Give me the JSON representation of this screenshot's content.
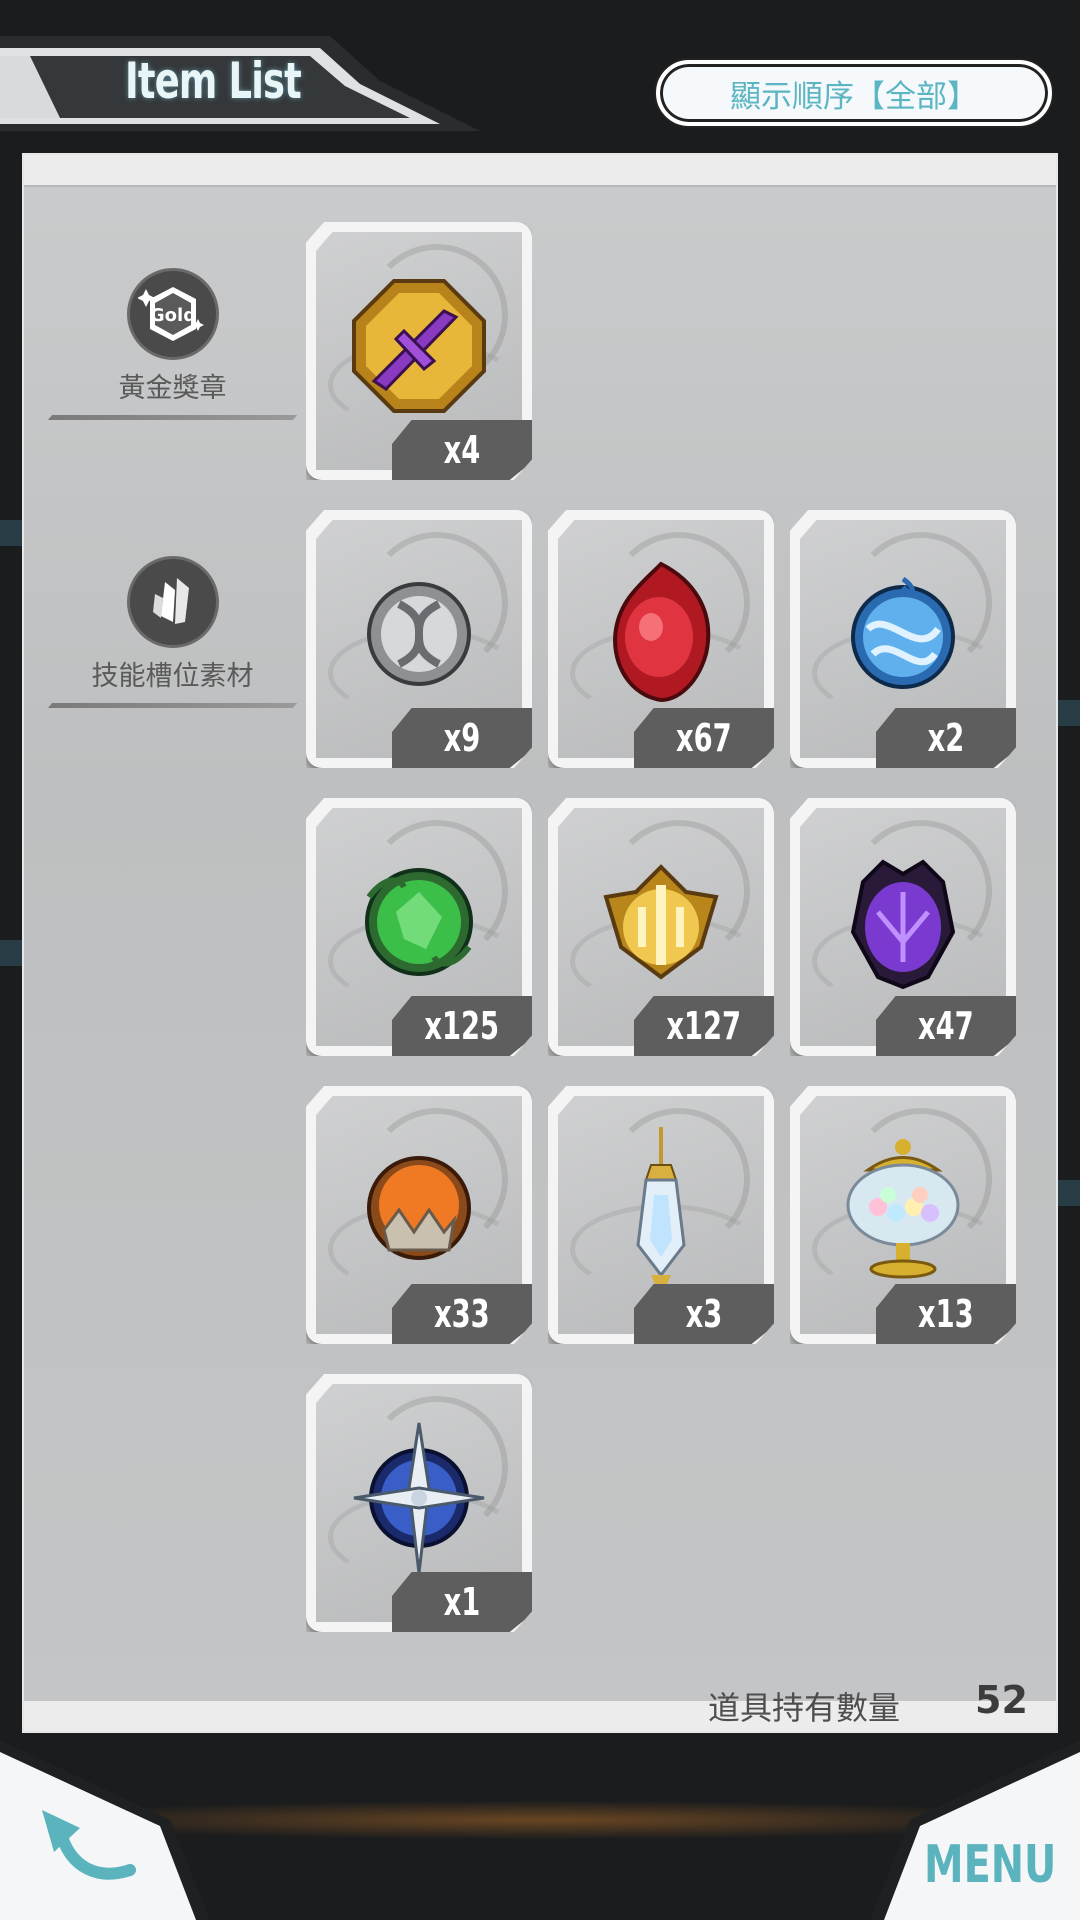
{
  "header": {
    "title": "Item List",
    "sort_button_label": "顯示順序【全部】"
  },
  "categories": [
    {
      "label": "黃金獎章",
      "icon": "gold-medal-icon",
      "badge_text": "Gold"
    },
    {
      "label": "技能槽位素材",
      "icon": "crystal-icon"
    }
  ],
  "items": [
    {
      "name": "gold-sword-medal",
      "qty": "x4",
      "color": "#d9a520"
    },
    {
      "name": "silver-knot-orb",
      "qty": "x9",
      "color": "#b7b9bd"
    },
    {
      "name": "red-flame-gem",
      "qty": "x67",
      "color": "#c8202a"
    },
    {
      "name": "blue-wave-orb",
      "qty": "x2",
      "color": "#3f8fd0"
    },
    {
      "name": "green-vine-gem",
      "qty": "x125",
      "color": "#2f9c3a"
    },
    {
      "name": "gold-crest-emblem",
      "qty": "x127",
      "color": "#e0b84a"
    },
    {
      "name": "purple-dragon-gem",
      "qty": "x47",
      "color": "#6a2fb0"
    },
    {
      "name": "orange-crystal-orb",
      "qty": "x33",
      "color": "#e06a1e"
    },
    {
      "name": "crystal-lantern",
      "qty": "x3",
      "color": "#c8d8e8"
    },
    {
      "name": "candy-jar",
      "qty": "x13",
      "color": "#c9d9e6"
    },
    {
      "name": "blue-star-compass",
      "qty": "x1",
      "color": "#2c4ea8"
    }
  ],
  "footer": {
    "count_label": "道具持有數量",
    "count_value": "52"
  },
  "nav": {
    "menu_label": "MENU",
    "back_icon": "back-arrow-icon"
  },
  "colors": {
    "accent": "#5ab3bd",
    "panel": "#c4c6c7",
    "background": "#1a1c1e"
  }
}
